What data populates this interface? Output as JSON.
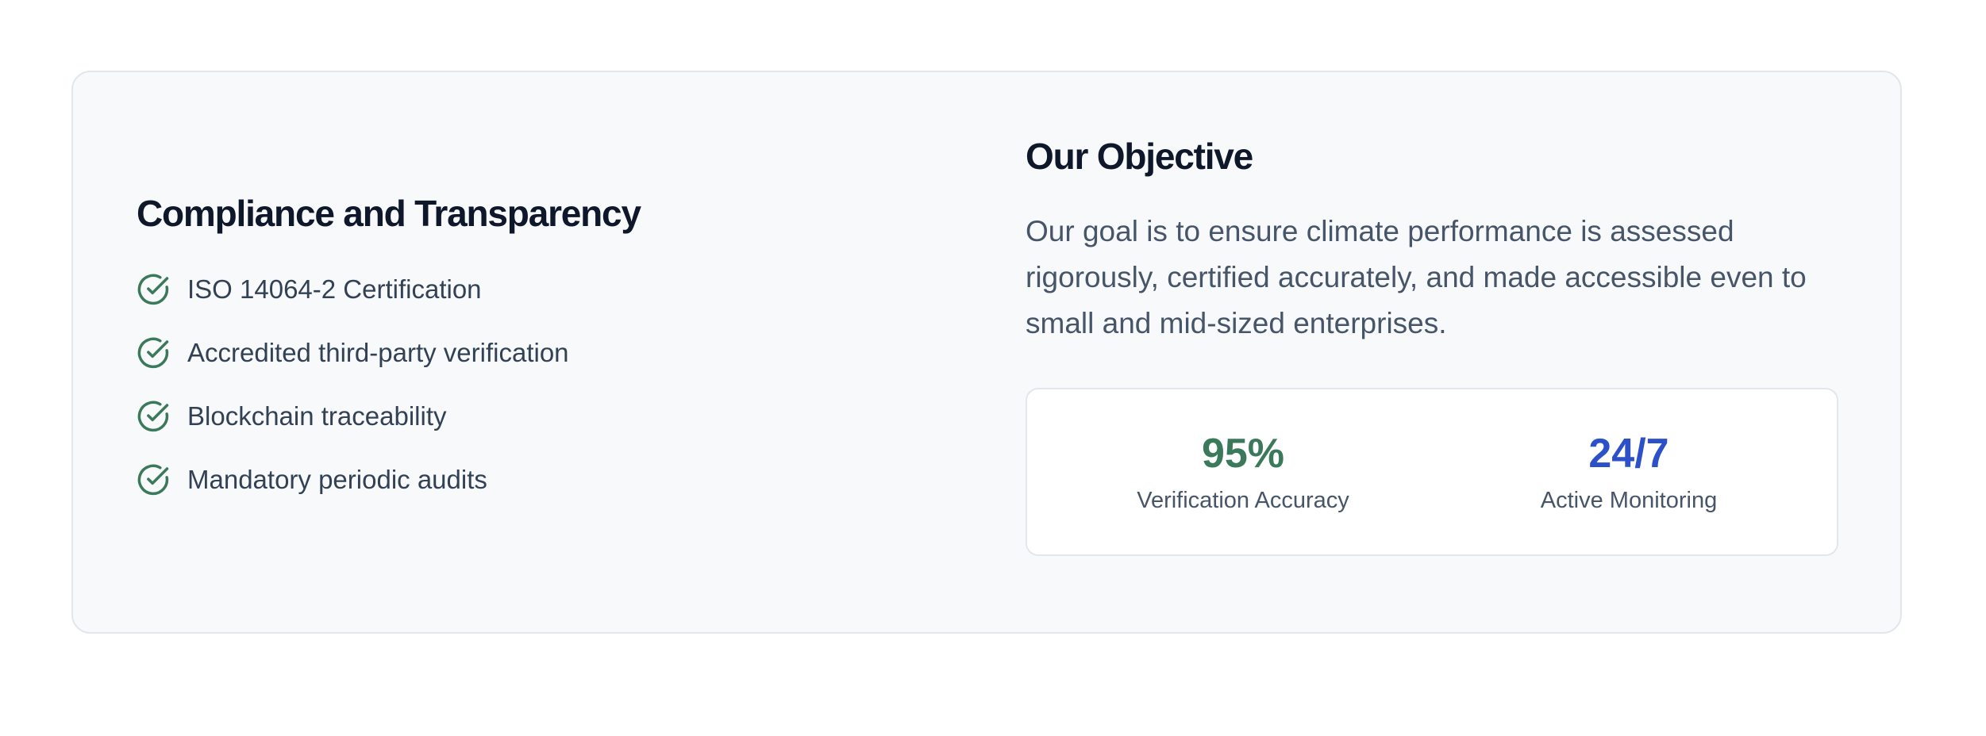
{
  "compliance": {
    "title": "Compliance and Transparency",
    "items": [
      {
        "label": "ISO 14064-2 Certification",
        "icon": "check-circle-icon"
      },
      {
        "label": "Accredited third-party verification",
        "icon": "check-circle-icon"
      },
      {
        "label": "Blockchain traceability",
        "icon": "check-circle-icon"
      },
      {
        "label": "Mandatory periodic audits",
        "icon": "check-circle-icon"
      }
    ]
  },
  "objective": {
    "title": "Our Objective",
    "description": "Our goal is to ensure climate performance is assessed rigorously, certified accurately, and made accessible even to small and mid-sized enterprises.",
    "stats": [
      {
        "value": "95%",
        "caption": "Verification Accuracy",
        "color": "#3a7a5a"
      },
      {
        "value": "24/7",
        "caption": "Active Monitoring",
        "color": "#2b50c8"
      }
    ]
  },
  "colors": {
    "panel_background": "#f8f9fb",
    "check_icon": "#3a7a5a"
  }
}
